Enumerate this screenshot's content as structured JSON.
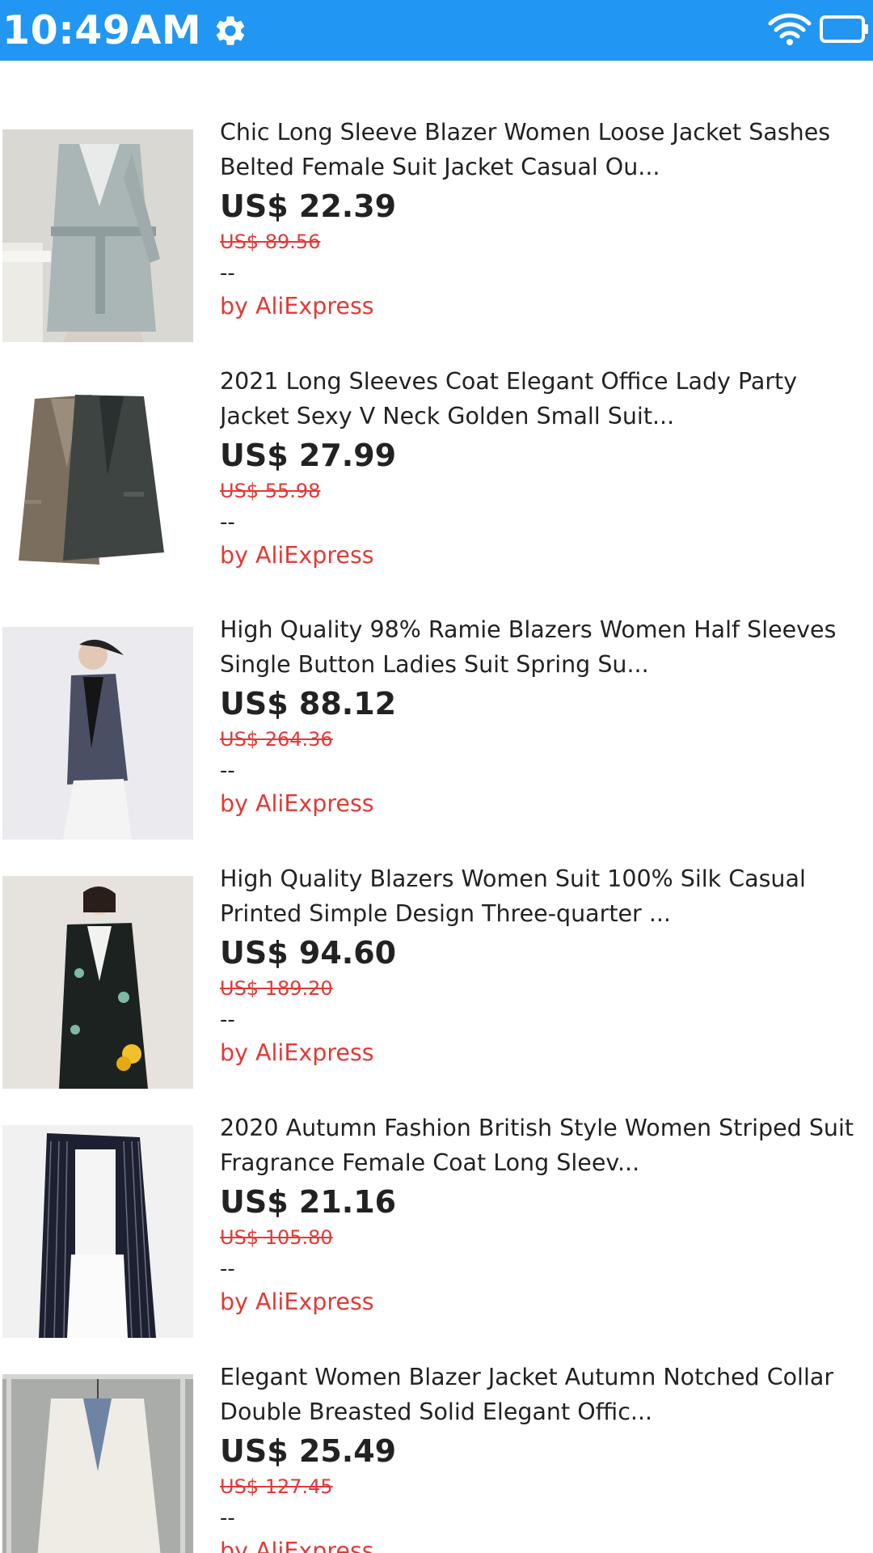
{
  "status_bar": {
    "time": "10:49AM",
    "settings_icon": "gear-icon",
    "wifi_icon": "wifi-icon",
    "battery_icon": "battery-icon",
    "background": "#2196F3"
  },
  "products": [
    {
      "title": "Chic Long Sleeve Blazer Women Loose Jacket Sashes Belted Female Suit Jacket Casual Ou...",
      "price": "US$ 22.39",
      "original_price": "US$ 89.56",
      "extra": "--",
      "seller": "by AliExpress"
    },
    {
      "title": "2021 Long Sleeves Coat Elegant Office Lady Party Jacket Sexy V Neck Golden Small Suit...",
      "price": "US$ 27.99",
      "original_price": "US$ 55.98",
      "extra": "--",
      "seller": "by AliExpress"
    },
    {
      "title": "High Quality 98% Ramie Blazers Women Half Sleeves Single Button Ladies Suit Spring Su...",
      "price": "US$ 88.12",
      "original_price": "US$ 264.36",
      "extra": "--",
      "seller": "by AliExpress"
    },
    {
      "title": "High Quality Blazers Women Suit 100% Silk Casual Printed Simple Design Three-quarter ...",
      "price": "US$ 94.60",
      "original_price": "US$ 189.20",
      "extra": "--",
      "seller": "by AliExpress"
    },
    {
      "title": "2020 Autumn Fashion British Style Women Striped Suit Fragrance Female Coat Long Sleev...",
      "price": "US$ 21.16",
      "original_price": "US$ 105.80",
      "extra": "--",
      "seller": "by AliExpress"
    },
    {
      "title": "Elegant Women Blazer Jacket Autumn Notched Collar Double Breasted Solid Elegant Offic...",
      "price": "US$ 25.49",
      "original_price": "US$ 127.45",
      "extra": "--",
      "seller": "by AliExpress"
    }
  ]
}
